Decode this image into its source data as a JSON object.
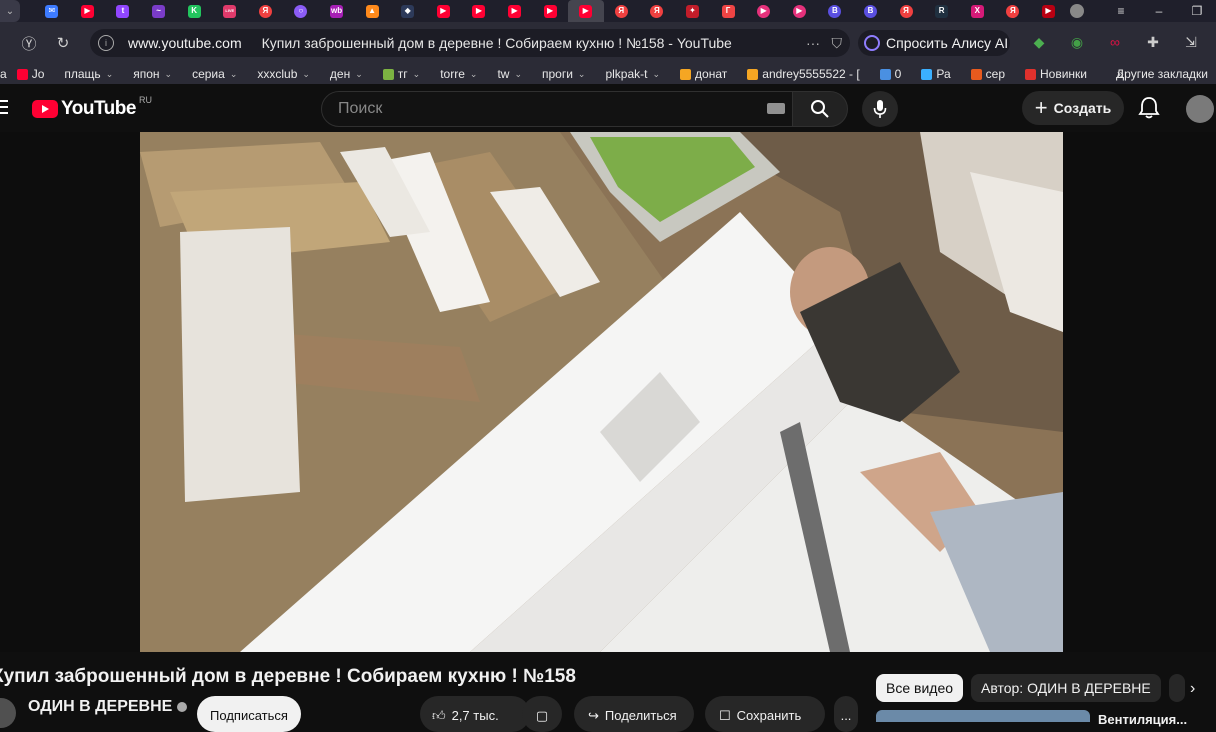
{
  "browser": {
    "tabs": [
      {
        "icon": "mail-icon",
        "color": "#3d7bff",
        "glyph": "✉",
        "round": false
      },
      {
        "icon": "youtube-icon",
        "color": "#ff0033",
        "glyph": "▶",
        "round": false
      },
      {
        "icon": "twitch-icon",
        "color": "#9146ff",
        "glyph": "t",
        "round": false
      },
      {
        "icon": "site-icon",
        "color": "#7a3cc8",
        "glyph": "~",
        "round": false
      },
      {
        "icon": "kinopoisk-icon",
        "color": "#22c55e",
        "glyph": "K",
        "round": false
      },
      {
        "icon": "site-icon",
        "color": "#e03a6b",
        "glyph": "LIVE",
        "round": false
      },
      {
        "icon": "yandex-icon",
        "color": "#f04040",
        "glyph": "Я",
        "round": true
      },
      {
        "icon": "ring-icon",
        "color": "#8b5cf6",
        "glyph": "○",
        "round": true
      },
      {
        "icon": "wildberries-icon",
        "color": "#a61fb5",
        "glyph": "wb",
        "round": false
      },
      {
        "icon": "fire-icon",
        "color": "#ff8a1c",
        "glyph": "▲",
        "round": false
      },
      {
        "icon": "game-icon",
        "color": "#2d3a5a",
        "glyph": "◆",
        "round": false
      },
      {
        "icon": "youtube-icon",
        "color": "#ff0033",
        "glyph": "▶",
        "round": false
      },
      {
        "icon": "youtube-icon",
        "color": "#ff0033",
        "glyph": "▶",
        "round": false
      },
      {
        "icon": "youtube-icon",
        "color": "#ff0033",
        "glyph": "▶",
        "round": false
      },
      {
        "icon": "youtube-icon",
        "color": "#ff0033",
        "glyph": "▶",
        "round": false
      },
      {
        "icon": "youtube-icon",
        "color": "#ff0033",
        "glyph": "▶",
        "round": false,
        "active": true
      },
      {
        "icon": "yandex-icon",
        "color": "#f04040",
        "glyph": "Я",
        "round": true
      },
      {
        "icon": "yandex-icon",
        "color": "#f04040",
        "glyph": "Я",
        "round": true
      },
      {
        "icon": "site-icon",
        "color": "#c21d2a",
        "glyph": "✦",
        "round": false
      },
      {
        "icon": "site-icon",
        "color": "#e44",
        "glyph": "Г",
        "round": false
      },
      {
        "icon": "play-circle-icon",
        "color": "#e5317b",
        "glyph": "▶",
        "round": true
      },
      {
        "icon": "play-circle-icon",
        "color": "#e5317b",
        "glyph": "▶",
        "round": true
      },
      {
        "icon": "b-icon",
        "color": "#5a4fe0",
        "glyph": "B",
        "round": true
      },
      {
        "icon": "b-icon",
        "color": "#5a4fe0",
        "glyph": "B",
        "round": true
      },
      {
        "icon": "yandex-icon",
        "color": "#f04040",
        "glyph": "Я",
        "round": true
      },
      {
        "icon": "r-icon",
        "color": "#203040",
        "glyph": "R",
        "round": false
      },
      {
        "icon": "x-icon",
        "color": "#d61a78",
        "glyph": "X",
        "round": false
      },
      {
        "icon": "yandex-icon",
        "color": "#f04040",
        "glyph": "Я",
        "round": true
      },
      {
        "icon": "youtube-icon",
        "color": "#b80012",
        "glyph": "▶",
        "round": false
      }
    ],
    "new_tab": "+",
    "window_controls": [
      "≡",
      "–",
      "❐"
    ],
    "url_domain": "www.youtube.com",
    "page_title": "Купил заброшенный дом в деревне ! Собираем кухню ! №158 - YouTube",
    "alice_label": "Спросить Алису AI",
    "bookmarks": [
      {
        "label": "Jo",
        "icon_color": "#ff0033",
        "chev": false
      },
      {
        "label": "плащь",
        "icon_color": "",
        "chev": true
      },
      {
        "label": "япон",
        "icon_color": "",
        "chev": true
      },
      {
        "label": "сериа",
        "icon_color": "",
        "chev": true
      },
      {
        "label": "xxxclub",
        "icon_color": "",
        "chev": true
      },
      {
        "label": "ден",
        "icon_color": "",
        "chev": true
      },
      {
        "label": "тг",
        "icon_color": "#7cb342",
        "chev": true
      },
      {
        "label": "torre",
        "icon_color": "",
        "chev": true
      },
      {
        "label": "tw",
        "icon_color": "",
        "chev": true
      },
      {
        "label": "проги",
        "icon_color": "",
        "chev": true
      },
      {
        "label": "plkpak-t",
        "icon_color": "",
        "chev": true
      },
      {
        "label": "донат",
        "icon_color": "#f5a623",
        "chev": false
      },
      {
        "label": "andrey5555522 - [",
        "icon_color": "#f5a623",
        "chev": false
      },
      {
        "label": "0",
        "icon_color": "#4a90e2",
        "chev": false
      },
      {
        "label": "Ра",
        "icon_color": "#3bb0ff",
        "chev": false
      },
      {
        "label": "сер",
        "icon_color": "#e85a1e",
        "chev": false
      },
      {
        "label": "Новинки",
        "icon_color": "#e0312d",
        "chev": false
      }
    ],
    "bookmarks_more": "»",
    "other_bookmarks": "Другие закладки"
  },
  "youtube": {
    "logo_text": "YouTube",
    "country_code": "RU",
    "search_placeholder": "Поиск",
    "create_label": "Создать",
    "video": {
      "title": "Купил заброшенный дом в деревне ! Собираем кухню ! №158"
    },
    "channel": {
      "name": "ОДИН В ДЕРЕВНЕ",
      "subscribe_label": "Подписаться"
    },
    "actions": {
      "likes": "2,7 тыс.",
      "share": "Поделиться",
      "save": "Сохранить",
      "more": "..."
    },
    "chips": [
      "Все видео",
      "Автор: ОДИН В ДЕРЕВНЕ"
    ],
    "recommendation_title": "Вентиляция..."
  }
}
